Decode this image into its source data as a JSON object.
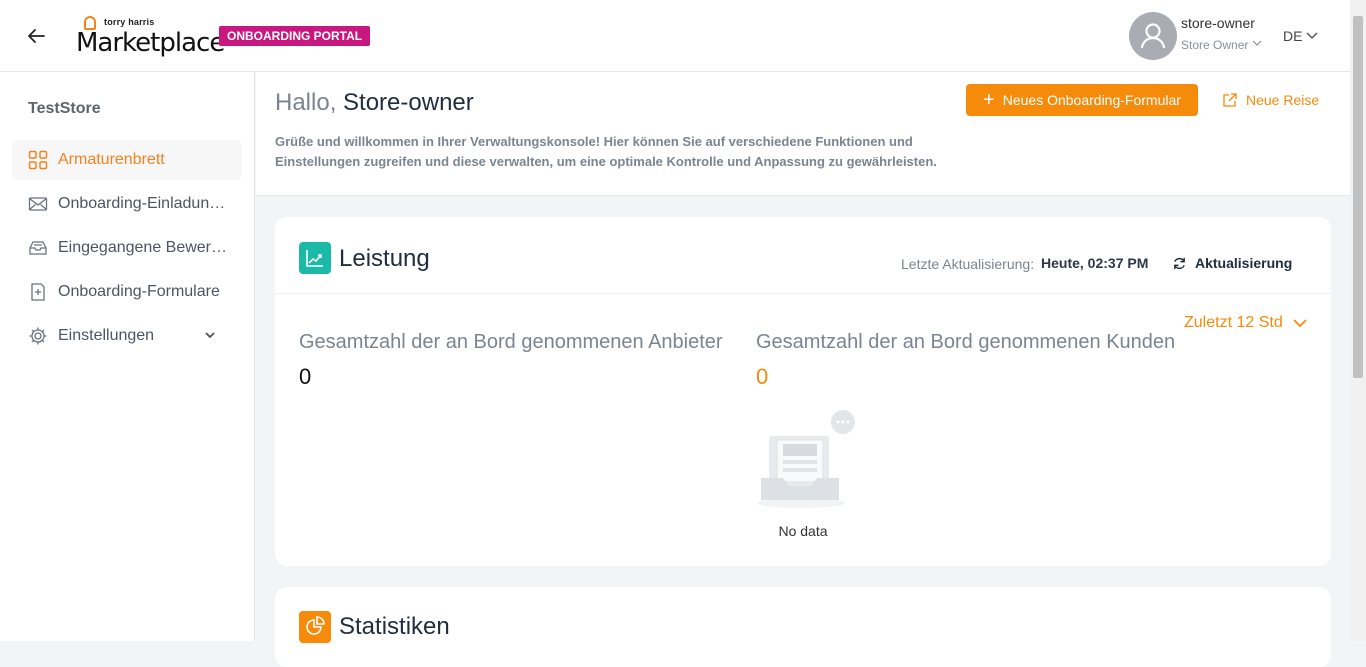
{
  "header": {
    "brand_small": "torry harris",
    "brand_big": "Marketplace",
    "badge": "ONBOARDING PORTAL",
    "user_name": "store-owner",
    "user_role": "Store Owner",
    "language": "DE"
  },
  "sidebar": {
    "store_name": "TestStore",
    "items": [
      {
        "label": "Armaturenbrett",
        "icon": "dashboard-grid-icon",
        "active": true
      },
      {
        "label": "Onboarding-Einladungen",
        "icon": "envelope-icon"
      },
      {
        "label": "Eingegangene Bewerbungen",
        "icon": "inbox-tray-icon"
      },
      {
        "label": "Onboarding-Formulare",
        "icon": "form-document-icon"
      },
      {
        "label": "Einstellungen",
        "icon": "gear-icon",
        "expandable": true
      }
    ]
  },
  "welcome": {
    "greeting": "Hallo,",
    "name": "Store-owner",
    "message": "Grüße und willkommen in Ihrer Verwaltungskonsole! Hier können Sie auf verschiedene Funktionen und Einstellungen zugreifen und diese verwalten, um eine optimale Kontrolle und Anpassung zu gewährleisten.",
    "new_form_button": "Neues Onboarding-Formular",
    "new_journey_link": "Neue Reise"
  },
  "performance": {
    "title": "Leistung",
    "last_update_label": "Letzte Aktualisierung:",
    "last_update_value": "Heute, 02:37 PM",
    "refresh_label": "Aktualisierung",
    "range_label": "Zuletzt 12 Std",
    "vendors_label": "Gesamtzahl der an Bord genommenen Anbieter",
    "vendors_value": "0",
    "customers_label": "Gesamtzahl der an Bord genommenen Kunden",
    "customers_value": "0",
    "empty_text": "No data"
  },
  "statistics": {
    "title": "Statistiken"
  },
  "colors": {
    "accent": "#f58a0b",
    "badge": "#c8177f",
    "teal": "#1bb9a8"
  }
}
